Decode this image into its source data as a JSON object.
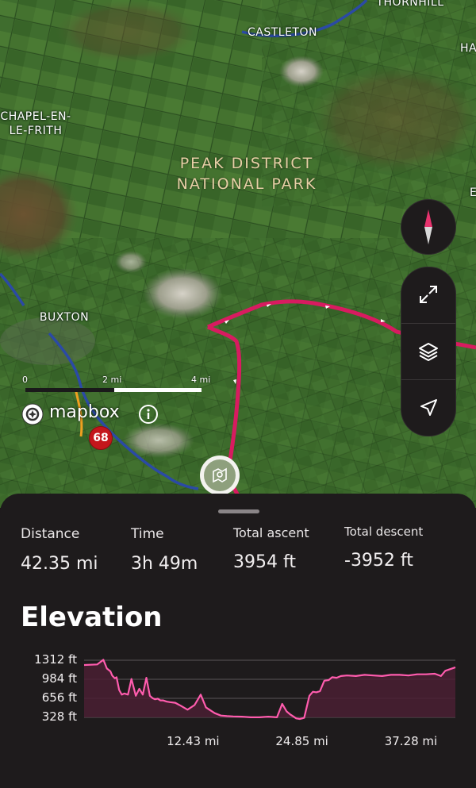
{
  "map": {
    "places": {
      "thornhill": "THORNHILL",
      "castleton": "CASTLETON",
      "ha": "HA",
      "chapel_line1": "CHAPEL-EN-",
      "chapel_line2": "LE-FRITH",
      "buxton": "BUXTON",
      "e": "E"
    },
    "park_label": {
      "line1": "PEAK DISTRICT",
      "line2": "NATIONAL PARK"
    },
    "scale": {
      "start": "0",
      "mid": "2 mi",
      "end": "4 mi"
    },
    "attribution": {
      "logo_text": "mapbox",
      "info_icon": "info-icon"
    },
    "road_shield": {
      "number": "68",
      "color": "#c4161c"
    },
    "route_color": "#d81b60",
    "controls": {
      "compass_icon": "compass-icon",
      "expand_icon": "expand-icon",
      "layers_icon": "layers-icon",
      "locate_icon": "navigation-arrow-icon"
    },
    "poi_marker_icon": "poi-marker-icon"
  },
  "sheet": {
    "stats": {
      "distance": {
        "label": "Distance",
        "value": "42.35 mi"
      },
      "time": {
        "label": "Time",
        "value": "3h 49m"
      },
      "ascent": {
        "label": "Total ascent",
        "value": "3954 ft"
      },
      "descent": {
        "label": "Total descent",
        "value": "-3952 ft"
      }
    },
    "elevation_title": "Elevation"
  },
  "chart_data": {
    "type": "area",
    "title": "Elevation",
    "xlabel": "",
    "ylabel": "",
    "y_ticks": [
      "1312 ft",
      "984 ft",
      "656 ft",
      "328 ft"
    ],
    "y_tick_values": [
      1312,
      984,
      656,
      328
    ],
    "x_ticks": [
      "12.43 mi",
      "24.85 mi",
      "37.28 mi"
    ],
    "x_tick_values": [
      12.43,
      24.85,
      37.28
    ],
    "xlim": [
      0,
      42.35
    ],
    "ylim": [
      200,
      1340
    ],
    "grid": true,
    "color": "#ff5cae",
    "x": [
      0,
      1.5,
      2.2,
      2.6,
      3.0,
      3.2,
      3.5,
      3.7,
      4.0,
      4.3,
      4.6,
      5.0,
      5.4,
      5.9,
      6.3,
      6.7,
      7.1,
      7.5,
      7.8,
      8.1,
      8.4,
      8.7,
      9.0,
      9.4,
      9.8,
      10.4,
      11.0,
      11.8,
      12.6,
      13.3,
      13.9,
      14.4,
      14.9,
      15.6,
      16.3,
      17.0,
      18.0,
      19.0,
      20.0,
      21.0,
      22.0,
      22.6,
      23.1,
      23.5,
      23.9,
      24.2,
      24.6,
      25.1,
      25.7,
      26.1,
      26.5,
      26.9,
      27.4,
      27.9,
      28.3,
      28.8,
      29.3,
      30.0,
      31.0,
      32.0,
      33.0,
      34.0,
      35.0,
      36.0,
      37.0,
      38.0,
      39.0,
      40.0,
      40.7,
      41.2,
      42.35
    ],
    "y": [
      1230,
      1240,
      1320,
      1170,
      1120,
      1050,
      1000,
      1020,
      800,
      720,
      740,
      720,
      990,
      700,
      820,
      720,
      1010,
      700,
      660,
      640,
      650,
      620,
      620,
      600,
      590,
      580,
      530,
      460,
      540,
      720,
      500,
      450,
      400,
      360,
      350,
      345,
      340,
      330,
      330,
      340,
      330,
      560,
      430,
      380,
      340,
      310,
      300,
      320,
      700,
      770,
      760,
      780,
      960,
      970,
      1020,
      1010,
      1040,
      1050,
      1040,
      1060,
      1050,
      1040,
      1060,
      1060,
      1050,
      1070,
      1070,
      1080,
      1040,
      1130,
      1190
    ]
  }
}
